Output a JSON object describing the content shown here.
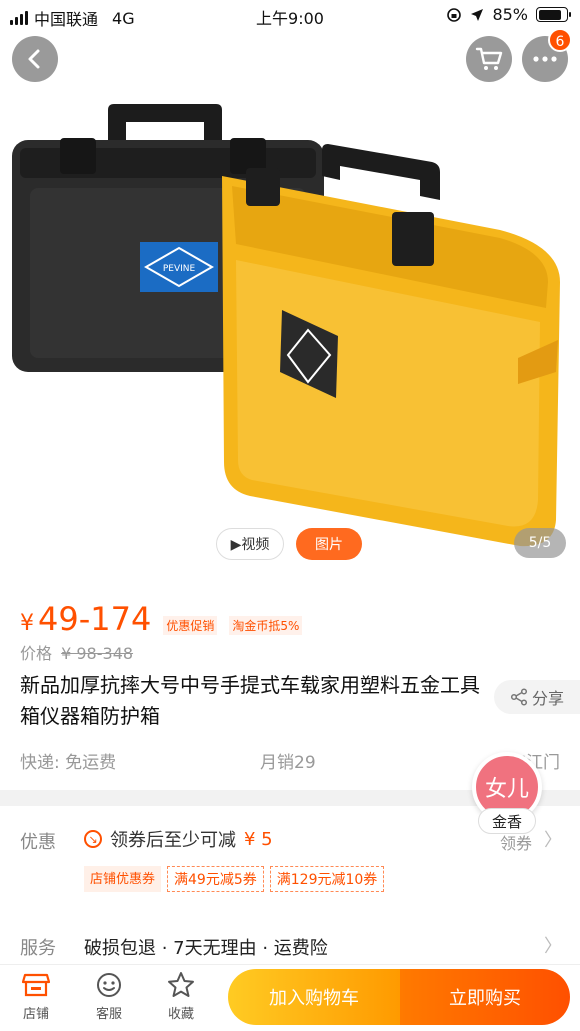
{
  "status_bar": {
    "carrier": "中国联通",
    "network": "4G",
    "time": "上午9:00",
    "battery": "85%",
    "battery_level": 0.85
  },
  "header": {
    "cart_badge": "6"
  },
  "hero": {
    "case_logo": "PEVINE",
    "video_label": "▶视频",
    "photo_label": "图片",
    "counter": "5/5"
  },
  "product": {
    "price_symbol": "¥",
    "price": "49-174",
    "promo_tag": "优惠促销",
    "coin_tag": "淘金币抵5%",
    "orig_label": "价格",
    "orig_price": "¥ 98-348",
    "title": "新品加厚抗摔大号中号手提式车载家用塑料五金工具箱仪器箱防护箱",
    "share_label": "分享",
    "shipping": "快递: 免运费",
    "monthly_sales": "月销29",
    "location": "广东江门"
  },
  "promo": {
    "label": "优惠",
    "coupon_text": "领券后至少可减",
    "coupon_amount": "¥ 5",
    "get_coupon": "领券",
    "tags": [
      "店铺优惠券",
      "满49元减5券",
      "满129元减10券"
    ]
  },
  "service": {
    "label": "服务",
    "text": "破损包退 · 7天无理由 · 运费险"
  },
  "floating": {
    "avatar_text": "女儿",
    "label": "金香"
  },
  "bottom_bar": {
    "store": "店铺",
    "support": "客服",
    "favorite": "收藏",
    "add_cart": "加入购物车",
    "buy_now": "立即购买"
  },
  "colors": {
    "accent": "#ff5000",
    "cart_button": "#ffb000",
    "case_black": "#2b2b2b",
    "case_yellow": "#f5b61b"
  }
}
